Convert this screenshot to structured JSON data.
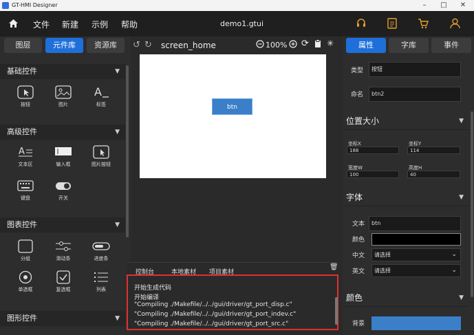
{
  "window": {
    "title": "GT-HMI Designer",
    "min": "–",
    "max": "□",
    "close": "✕"
  },
  "menu": {
    "items": [
      "文件",
      "新建",
      "示例",
      "帮助"
    ],
    "file_title": "demo1.gtui"
  },
  "left": {
    "tabs": [
      "图层",
      "元件库",
      "资源库"
    ],
    "sections": {
      "basic": "基础控件",
      "advanced": "高级控件",
      "chart": "图表控件",
      "graphic": "图形控件"
    },
    "basic_items": [
      "按钮",
      "图片",
      "标签"
    ],
    "advanced_items": [
      "文本区",
      "输入框",
      "图片按钮",
      "键盘",
      "开关"
    ],
    "chart_items": [
      "分组",
      "滑动条",
      "进度条",
      "单选框",
      "复选框",
      "列表"
    ]
  },
  "center": {
    "screen_name": "screen_home",
    "zoom": "100%",
    "canvas_button": "btn",
    "tabs": [
      "控制台",
      "本地素材",
      "项目素材"
    ],
    "console_lines": [
      "开始生成代码",
      "开始编译",
      "\"Compiling ./Makefile/../../gui/driver/gt_port_disp.c\"",
      "\"Compiling ./Makefile/../../gui/driver/gt_port_indev.c\"",
      "\"Compiling ./Makefile/../../gui/driver/gt_port_src.c\""
    ]
  },
  "right": {
    "tabs": [
      "属性",
      "字库",
      "事件"
    ],
    "type_label": "类型",
    "type_value": "按钮",
    "name_label": "命名",
    "name_value": "btn2",
    "pos_section": "位置大小",
    "x_label": "坐标X",
    "x_value": "188",
    "y_label": "坐标Y",
    "y_value": "114",
    "w_label": "宽度W",
    "w_value": "100",
    "h_label": "高度H",
    "h_value": "40",
    "font_section": "字体",
    "text_label": "文本",
    "text_value": "btn",
    "color_label": "颜色",
    "cn_label": "中文",
    "cn_value": "请选择",
    "en_label": "英文",
    "en_value": "请选择",
    "color_section": "颜色",
    "bg_label": "背景"
  },
  "colors": {
    "accent": "#1e6fd9",
    "canvas_button": "#3a7fc8",
    "console_highlight": "#e0312f",
    "icon_accent": "#e0a030"
  }
}
